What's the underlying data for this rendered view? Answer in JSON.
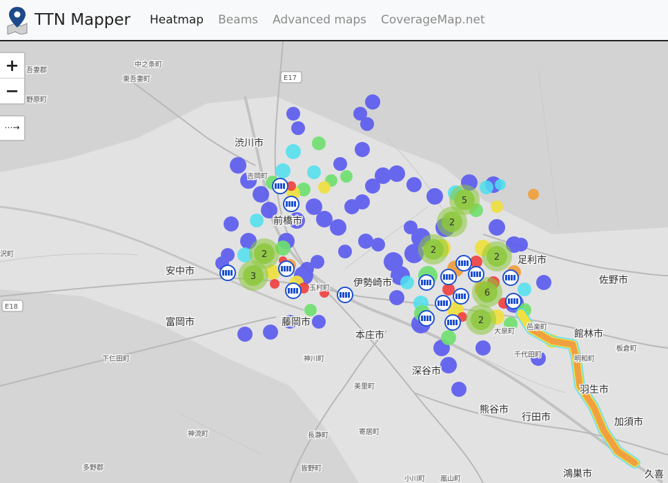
{
  "nav": {
    "brand": "TTN Mapper",
    "links": [
      "Heatmap",
      "Beams",
      "Advanced maps",
      "CoverageMap.net"
    ],
    "active_index": 0
  },
  "controls": {
    "zoom_in": "+",
    "zoom_out": "−",
    "locate": "⋯→"
  },
  "map_labels": [
    {
      "text": "中之条町",
      "cls": "sm"
    },
    {
      "text": "東吾妻町",
      "cls": "sm"
    },
    {
      "text": "吾妻郡",
      "cls": "sm"
    },
    {
      "text": "野原町",
      "cls": "sm"
    },
    {
      "text": "E17",
      "cls": "shield"
    },
    {
      "text": "渋川市",
      "cls": "big"
    },
    {
      "text": "吉岡町",
      "cls": "sm"
    },
    {
      "text": "前橋市",
      "cls": "big"
    },
    {
      "text": "安中市",
      "cls": "big"
    },
    {
      "text": "沢町",
      "cls": "sm"
    },
    {
      "text": "E18",
      "cls": "shield"
    },
    {
      "text": "富岡市",
      "cls": "big"
    },
    {
      "text": "玉村町",
      "cls": "sm"
    },
    {
      "text": "伊勢崎市",
      "cls": "big"
    },
    {
      "text": "藤岡市",
      "cls": "big"
    },
    {
      "text": "本庄市",
      "cls": "big"
    },
    {
      "text": "下仁田町",
      "cls": "sm"
    },
    {
      "text": "神川町",
      "cls": "sm"
    },
    {
      "text": "深谷市",
      "cls": "big"
    },
    {
      "text": "美里町",
      "cls": "sm"
    },
    {
      "text": "熊谷市",
      "cls": "big"
    },
    {
      "text": "行田市",
      "cls": "big"
    },
    {
      "text": "神流町",
      "cls": "sm"
    },
    {
      "text": "長瀞町",
      "cls": "sm"
    },
    {
      "text": "寄居町",
      "cls": "sm"
    },
    {
      "text": "多野郡",
      "cls": "sm"
    },
    {
      "text": "皆野町",
      "cls": "sm"
    },
    {
      "text": "小川町",
      "cls": "sm"
    },
    {
      "text": "嵐山町",
      "cls": "sm"
    },
    {
      "text": "鴻巣市",
      "cls": "big"
    },
    {
      "text": "足利市",
      "cls": "big"
    },
    {
      "text": "佐野市",
      "cls": "big"
    },
    {
      "text": "館林市",
      "cls": "big"
    },
    {
      "text": "板倉町",
      "cls": "sm"
    },
    {
      "text": "邑楽町",
      "cls": "sm"
    },
    {
      "text": "大泉町",
      "cls": "sm"
    },
    {
      "text": "千代田町",
      "cls": "sm"
    },
    {
      "text": "明和町",
      "cls": "sm"
    },
    {
      "text": "羽生市",
      "cls": "big"
    },
    {
      "text": "加須市",
      "cls": "big"
    },
    {
      "text": "久喜",
      "cls": "big"
    }
  ],
  "clusters": [
    {
      "count": "5"
    },
    {
      "count": "2"
    },
    {
      "count": "2"
    },
    {
      "count": "2"
    },
    {
      "count": "6"
    },
    {
      "count": "2"
    },
    {
      "count": "2"
    },
    {
      "count": "3"
    }
  ],
  "colors": {
    "heat_blue": "#5a5af0",
    "heat_cyan": "#4fe0f0",
    "heat_green": "#6ee06e",
    "heat_yellow": "#f0e040",
    "heat_orange": "#f0a040",
    "heat_red": "#f04040",
    "cluster_green": "#8cc83c",
    "marker_blue": "#1a4fd0"
  }
}
